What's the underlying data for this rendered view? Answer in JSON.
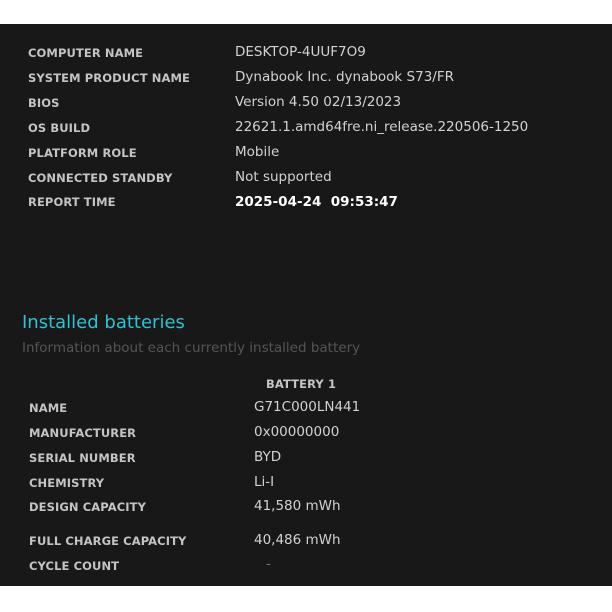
{
  "system_info": [
    {
      "label": "COMPUTER NAME",
      "value": "DESKTOP-4UUF7O9"
    },
    {
      "label": "SYSTEM PRODUCT NAME",
      "value": "Dynabook Inc. dynabook S73/FR"
    },
    {
      "label": "BIOS",
      "value": "Version 4.50 02/13/2023"
    },
    {
      "label": "OS BUILD",
      "value": "22621.1.amd64fre.ni_release.220506-1250"
    },
    {
      "label": "PLATFORM ROLE",
      "value": "Mobile"
    },
    {
      "label": "CONNECTED STANDBY",
      "value": "Not supported"
    },
    {
      "label": "REPORT TIME",
      "value": "2025-04-24  09:53:47"
    }
  ],
  "batteries": {
    "title": "Installed batteries",
    "subtitle": "Information about each currently installed battery",
    "column_header": "BATTERY 1",
    "rows": [
      {
        "label": "NAME",
        "value": "G71C000LN441"
      },
      {
        "label": "MANUFACTURER",
        "value": "0x00000000"
      },
      {
        "label": "SERIAL NUMBER",
        "value": "BYD"
      },
      {
        "label": "CHEMISTRY",
        "value": "Li-I"
      },
      {
        "label": "DESIGN CAPACITY",
        "value": "41,580 mWh"
      },
      {
        "label": "FULL CHARGE CAPACITY",
        "value": "40,486 mWh"
      },
      {
        "label": "CYCLE COUNT",
        "value": "-"
      }
    ]
  }
}
